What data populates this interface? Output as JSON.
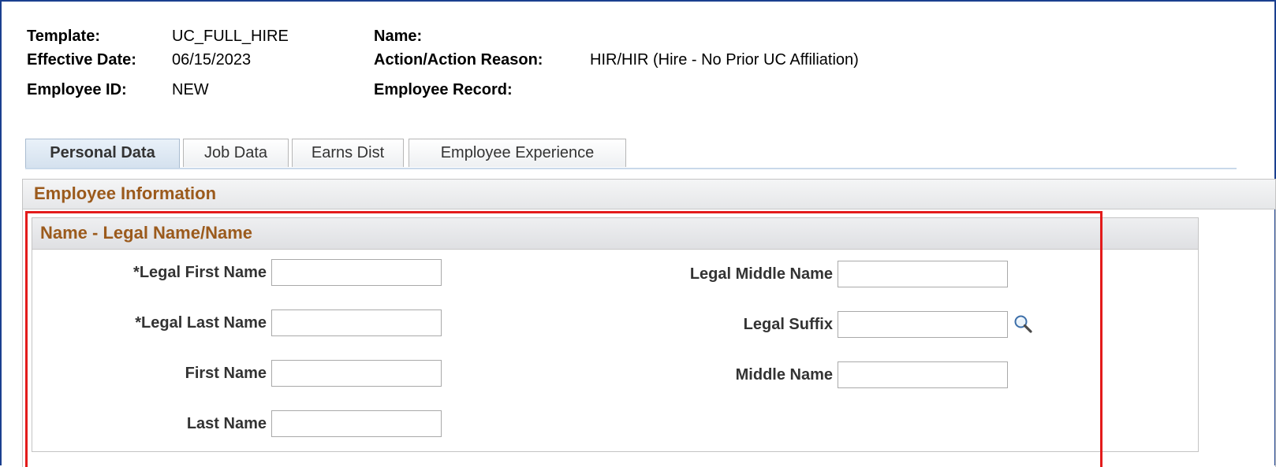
{
  "header": {
    "template_label": "Template:",
    "template_value": "UC_FULL_HIRE",
    "effective_date_label": "Effective Date:",
    "effective_date_value": "06/15/2023",
    "employee_id_label": "Employee ID:",
    "employee_id_value": "NEW",
    "name_label": "Name:",
    "action_label": "Action/Action Reason:",
    "action_value": "HIR/HIR (Hire - No Prior UC Affiliation)",
    "employee_record_label": "Employee Record:"
  },
  "tabs": [
    {
      "label": "Personal Data",
      "active": true
    },
    {
      "label": "Job Data",
      "active": false
    },
    {
      "label": "Earns Dist",
      "active": false
    },
    {
      "label": "Employee Experience",
      "active": false
    }
  ],
  "section": {
    "title": "Employee Information",
    "group_title": "Name - Legal Name/Name",
    "fields": {
      "legal_first_name": {
        "label": "*Legal First Name",
        "value": ""
      },
      "legal_last_name": {
        "label": "*Legal Last Name",
        "value": ""
      },
      "first_name": {
        "label": "First Name",
        "value": ""
      },
      "last_name": {
        "label": "Last Name",
        "value": ""
      },
      "legal_middle_name": {
        "label": "Legal Middle Name",
        "value": ""
      },
      "legal_suffix": {
        "label": "Legal Suffix",
        "value": ""
      },
      "middle_name": {
        "label": "Middle Name",
        "value": ""
      }
    }
  },
  "colors": {
    "frame_border": "#1a3f8f",
    "section_title": "#9b5a1c",
    "highlight_box": "#e31b1b"
  },
  "icons": {
    "lookup": "magnifier-icon"
  }
}
